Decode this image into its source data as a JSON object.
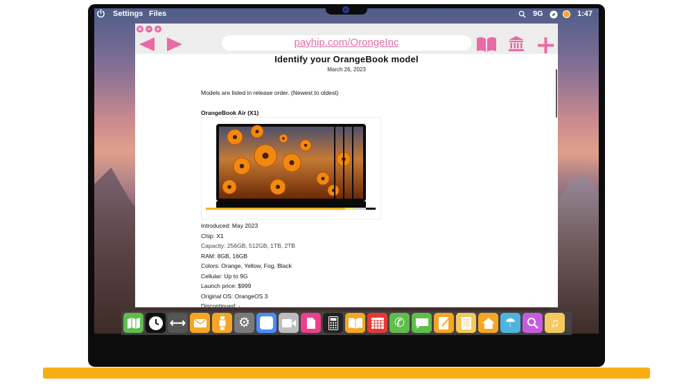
{
  "menubar": {
    "settings_label": "Settings",
    "files_label": "Files",
    "network": "9G",
    "clock": "1:47"
  },
  "browser": {
    "url": "payhip.com/OrongeInc"
  },
  "article": {
    "title": "Identify your OrangeBook model",
    "date": "March 26, 2023",
    "intro": "Models are listed in release order. (Newest to oldest)",
    "model_name": "OrangeBook Air (X1)",
    "specs": [
      "Introduced: May 2023",
      "Chip: X1",
      "Capacity: 256GB, 512GB, 1TB, 2TB",
      "RAM: 8GB, 16GB",
      "Colors: Orange, Yellow, Fog, Black",
      "Cellular: Up to 9G",
      "Launch price: $999",
      "Original OS: OrangeOS 3",
      "Discontinued: -"
    ]
  },
  "dock": {
    "apps": [
      {
        "name": "maps-icon",
        "color": "#5fbd4c"
      },
      {
        "name": "clock-icon",
        "color": "#111111"
      },
      {
        "name": "resize-arrows-icon",
        "color": "#555555"
      },
      {
        "name": "mail-icon",
        "color": "#f6a623"
      },
      {
        "name": "watch-icon",
        "color": "#f6a623"
      },
      {
        "name": "gear-icon",
        "color": "#7a7a7a"
      },
      {
        "name": "blank-app-icon",
        "color": "#4a8cff"
      },
      {
        "name": "video-camera-icon",
        "color": "#bdbdbd"
      },
      {
        "name": "document-icon",
        "color": "#ee3e8e"
      },
      {
        "name": "calculator-icon",
        "color": "#222222"
      },
      {
        "name": "book-icon",
        "color": "#f6a623"
      },
      {
        "name": "calendar-icon",
        "color": "#e53935"
      },
      {
        "name": "phone-icon",
        "color": "#5fbd4c"
      },
      {
        "name": "messages-icon",
        "color": "#5fbd4c"
      },
      {
        "name": "notes-icon",
        "color": "#f6a623"
      },
      {
        "name": "pages-icon",
        "color": "#f4c95d"
      },
      {
        "name": "home-icon",
        "color": "#f6a623"
      },
      {
        "name": "umbrella-icon",
        "color": "#4fb3e0"
      },
      {
        "name": "search-icon",
        "color": "#c65ce0"
      },
      {
        "name": "music-icon",
        "color": "#f4c95d"
      }
    ]
  },
  "colors": {
    "accent": "#e96aa4",
    "base_bar": "#f8ae13"
  }
}
